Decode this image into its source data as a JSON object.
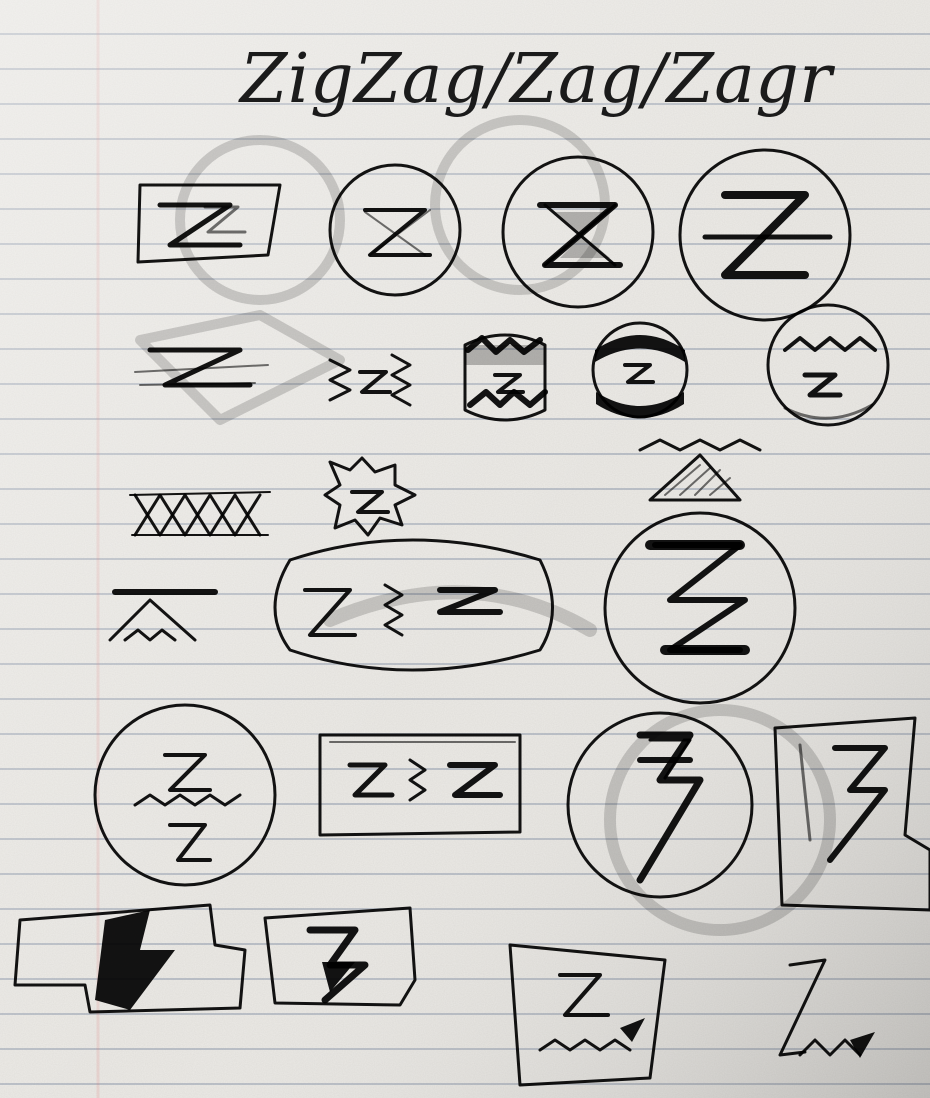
{
  "header": {
    "title": "ZigZag/Zag/Zagr"
  }
}
